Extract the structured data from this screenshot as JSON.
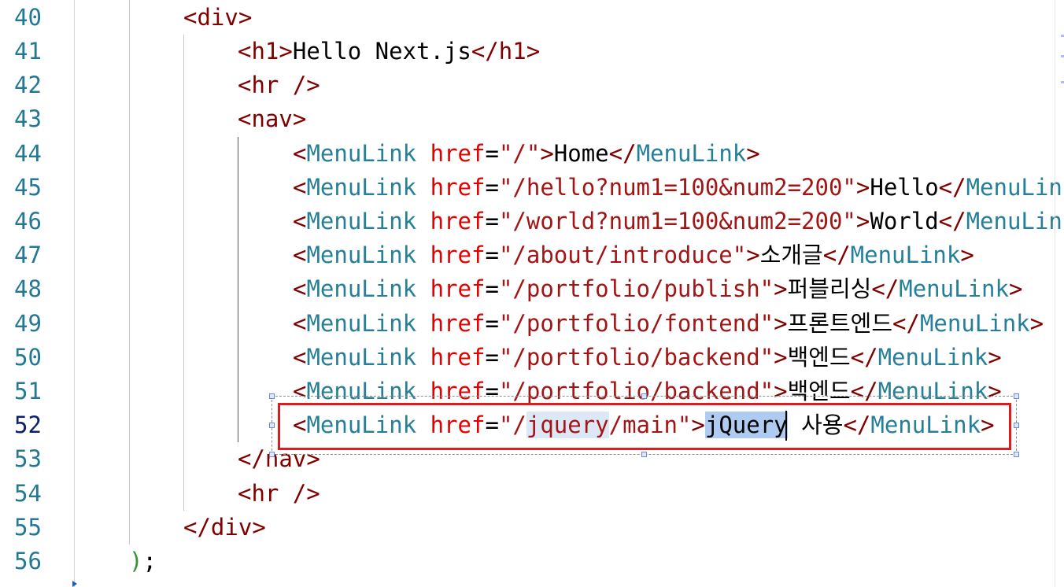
{
  "editor": {
    "line_numbers": [
      "40",
      "41",
      "42",
      "43",
      "44",
      "45",
      "46",
      "47",
      "48",
      "49",
      "50",
      "51",
      "52",
      "53",
      "54",
      "55",
      "56"
    ],
    "active_line": "52",
    "lines": {
      "l40": {
        "open": "<",
        "tag": "div",
        "close": ">"
      },
      "l41": {
        "open": "<",
        "tag": "h1",
        "close": ">",
        "text": "Hello Next.js",
        "end_open": "</",
        "end_tag": "h1",
        "end_close": ">"
      },
      "l42": {
        "open": "<",
        "tag": "hr",
        "close": " />"
      },
      "l43": {
        "open": "<",
        "tag": "nav",
        "close": ">"
      },
      "l44": {
        "open": "<",
        "comp": "MenuLink",
        "attr": "href",
        "eq": "=",
        "value": "\"/\"",
        "close": ">",
        "text": "Home",
        "end_open": "</",
        "end_comp": "MenuLink",
        "end_close": ">"
      },
      "l45": {
        "open": "<",
        "comp": "MenuLink",
        "attr": "href",
        "eq": "=",
        "value": "\"/hello?num1=100&num2=200\"",
        "close": ">",
        "text": "Hello",
        "end_open": "</",
        "end_comp": "MenuLin"
      },
      "l46": {
        "open": "<",
        "comp": "MenuLink",
        "attr": "href",
        "eq": "=",
        "value": "\"/world?num1=100&num2=200\"",
        "close": ">",
        "text": "World",
        "end_open": "</",
        "end_comp": "MenuLin"
      },
      "l47": {
        "open": "<",
        "comp": "MenuLink",
        "attr": "href",
        "eq": "=",
        "value": "\"/about/introduce\"",
        "close": ">",
        "text": "소개글",
        "end_open": "</",
        "end_comp": "MenuLink",
        "end_close": ">"
      },
      "l48": {
        "open": "<",
        "comp": "MenuLink",
        "attr": "href",
        "eq": "=",
        "value": "\"/portfolio/publish\"",
        "close": ">",
        "text": "퍼블리싱",
        "end_open": "</",
        "end_comp": "MenuLink",
        "end_close": ">"
      },
      "l49": {
        "open": "<",
        "comp": "MenuLink",
        "attr": "href",
        "eq": "=",
        "value": "\"/portfolio/fontend\"",
        "close": ">",
        "text": "프론트엔드",
        "end_open": "</",
        "end_comp": "MenuLink",
        "end_close": ">"
      },
      "l50": {
        "open": "<",
        "comp": "MenuLink",
        "attr": "href",
        "eq": "=",
        "value": "\"/portfolio/backend\"",
        "close": ">",
        "text": "백엔드",
        "end_open": "</",
        "end_comp": "MenuLink",
        "end_close": ">"
      },
      "l51": {
        "open": "<",
        "comp": "MenuLink",
        "attr": "href",
        "eq": "=",
        "value": "\"/portfolio/backend\"",
        "close": ">",
        "text": "백엔드",
        "end_open": "</",
        "end_comp": "MenuLink",
        "end_close": ">"
      },
      "l52": {
        "open": "<",
        "comp": "MenuLink",
        "attr": "href",
        "eq": "=",
        "q1": "\"/",
        "v_hl": "jquery",
        "v_rest": "/main\"",
        "close": ">",
        "sel": "jQuery",
        "text": " 사용",
        "end_open": "</",
        "end_comp": "MenuLink",
        "end_close": ">"
      },
      "l53": {
        "open": "</",
        "tag": "nav",
        "close": ">"
      },
      "l54": {
        "open": "<",
        "tag": "hr",
        "close": " />"
      },
      "l55": {
        "open": "</",
        "tag": "div",
        "close": ">"
      },
      "l56": {
        "paren": ")",
        "semi": ";"
      }
    }
  },
  "colors": {
    "line_number": "#237893",
    "tag": "#800000",
    "component": "#267f99",
    "attribute": "#e50000",
    "string": "#a31515",
    "highlight_box": "#e01b1b",
    "selection": "#aecbf1"
  }
}
